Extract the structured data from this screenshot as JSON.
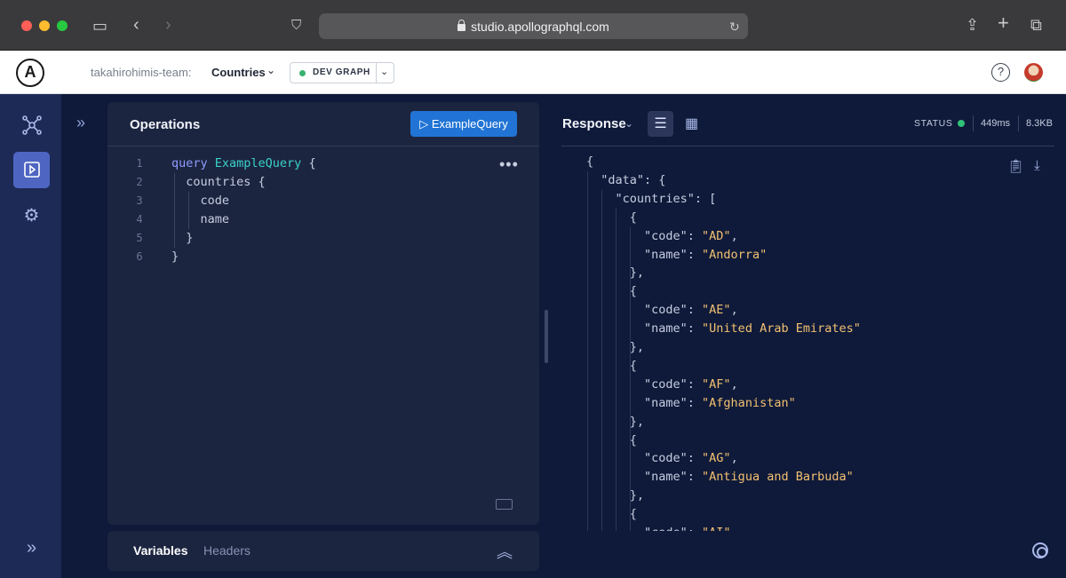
{
  "browser": {
    "url": "studio.apollographql.com"
  },
  "header": {
    "logo_letter": "A",
    "team": "takahirohimis-team:",
    "graph_name": "Countries",
    "variant_label": "DEV GRAPH",
    "help_label": "?"
  },
  "operations": {
    "title": "Operations",
    "run_label": "▷ ExampleQuery",
    "more_label": "•••",
    "code": [
      {
        "num": "1",
        "parts": [
          {
            "t": "query ",
            "c": "kw"
          },
          {
            "t": "ExampleQuery",
            "c": "fn"
          },
          {
            "t": " {",
            "c": ""
          }
        ]
      },
      {
        "num": "2",
        "parts": [
          {
            "t": "  countries {",
            "c": ""
          }
        ]
      },
      {
        "num": "3",
        "parts": [
          {
            "t": "    code",
            "c": ""
          }
        ]
      },
      {
        "num": "4",
        "parts": [
          {
            "t": "    name",
            "c": ""
          }
        ]
      },
      {
        "num": "5",
        "parts": [
          {
            "t": "  }",
            "c": ""
          }
        ]
      },
      {
        "num": "6",
        "parts": [
          {
            "t": "}",
            "c": ""
          }
        ]
      }
    ]
  },
  "variables": {
    "tab_variables": "Variables",
    "tab_headers": "Headers"
  },
  "response": {
    "title": "Response",
    "status_label": "STATUS",
    "time": "449ms",
    "size": "8.3KB",
    "json_lines": [
      [
        {
          "t": "{",
          "c": ""
        }
      ],
      [
        {
          "t": "  \"data\": {",
          "c": ""
        }
      ],
      [
        {
          "t": "    \"countries\": [",
          "c": ""
        }
      ],
      [
        {
          "t": "      {",
          "c": ""
        }
      ],
      [
        {
          "t": "        \"code\": ",
          "c": ""
        },
        {
          "t": "\"AD\"",
          "c": "jstr"
        },
        {
          "t": ",",
          "c": ""
        }
      ],
      [
        {
          "t": "        \"name\": ",
          "c": ""
        },
        {
          "t": "\"Andorra\"",
          "c": "jstr"
        }
      ],
      [
        {
          "t": "      },",
          "c": ""
        }
      ],
      [
        {
          "t": "      {",
          "c": ""
        }
      ],
      [
        {
          "t": "        \"code\": ",
          "c": ""
        },
        {
          "t": "\"AE\"",
          "c": "jstr"
        },
        {
          "t": ",",
          "c": ""
        }
      ],
      [
        {
          "t": "        \"name\": ",
          "c": ""
        },
        {
          "t": "\"United Arab Emirates\"",
          "c": "jstr"
        }
      ],
      [
        {
          "t": "      },",
          "c": ""
        }
      ],
      [
        {
          "t": "      {",
          "c": ""
        }
      ],
      [
        {
          "t": "        \"code\": ",
          "c": ""
        },
        {
          "t": "\"AF\"",
          "c": "jstr"
        },
        {
          "t": ",",
          "c": ""
        }
      ],
      [
        {
          "t": "        \"name\": ",
          "c": ""
        },
        {
          "t": "\"Afghanistan\"",
          "c": "jstr"
        }
      ],
      [
        {
          "t": "      },",
          "c": ""
        }
      ],
      [
        {
          "t": "      {",
          "c": ""
        }
      ],
      [
        {
          "t": "        \"code\": ",
          "c": ""
        },
        {
          "t": "\"AG\"",
          "c": "jstr"
        },
        {
          "t": ",",
          "c": ""
        }
      ],
      [
        {
          "t": "        \"name\": ",
          "c": ""
        },
        {
          "t": "\"Antigua and Barbuda\"",
          "c": "jstr"
        }
      ],
      [
        {
          "t": "      },",
          "c": ""
        }
      ],
      [
        {
          "t": "      {",
          "c": ""
        }
      ],
      [
        {
          "t": "        \"code\": ",
          "c": ""
        },
        {
          "t": "\"AI\"",
          "c": "jstr"
        },
        {
          "t": ",",
          "c": ""
        }
      ]
    ]
  },
  "colors": {
    "accent": "#2174d5",
    "status_ok": "#30c178",
    "string": "#f2c071",
    "keyword": "#8f9bff",
    "op_name": "#3ad1c8"
  }
}
